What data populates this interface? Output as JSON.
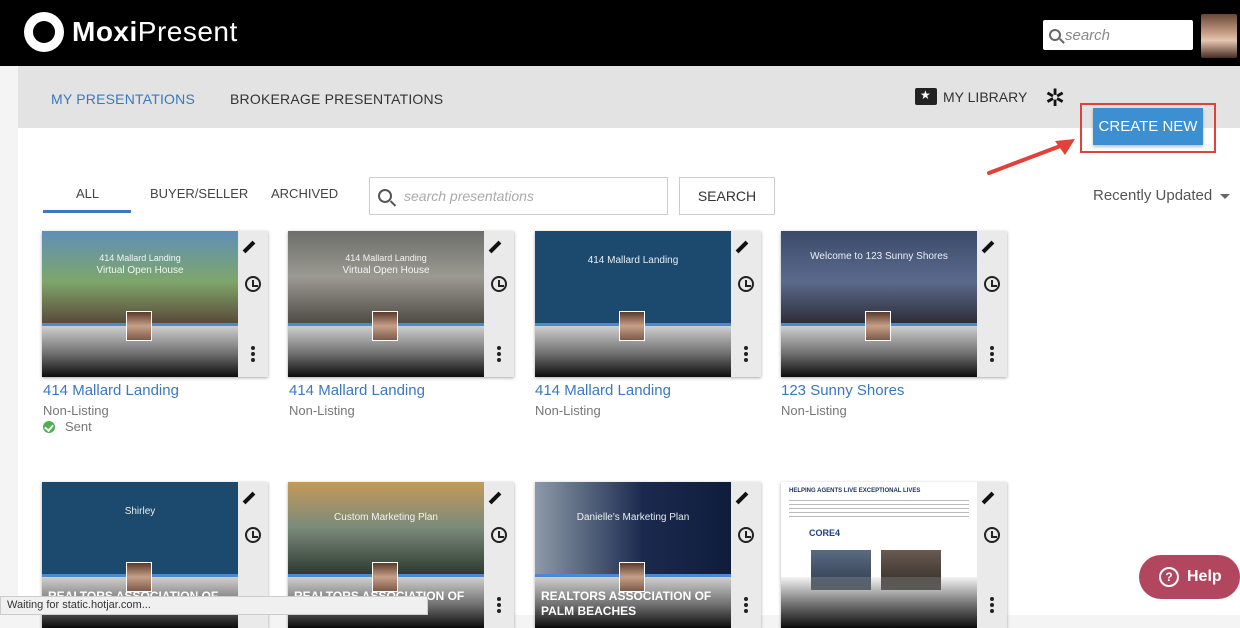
{
  "app": {
    "logo_bold": "Moxi",
    "logo_light": "Present",
    "search_placeholder": "search"
  },
  "nav": {
    "tabs": [
      "MY PRESENTATIONS",
      "BROKERAGE PRESENTATIONS"
    ],
    "library": "MY LIBRARY",
    "create_new": "CREATE NEW"
  },
  "filters": {
    "tabs": [
      "ALL",
      "BUYER/SELLER",
      "ARCHIVED"
    ],
    "search_placeholder": "search presentations",
    "search_button": "SEARCH",
    "sort": "Recently Updated"
  },
  "cards": [
    {
      "title": "414 Mallard Landing",
      "subtitle": "Non-Listing",
      "status": "Sent",
      "thumb_line": "414 Mallard Landing",
      "thumb_title": "Virtual Open House"
    },
    {
      "title": "414 Mallard Landing",
      "subtitle": "Non-Listing",
      "thumb_line": "414 Mallard Landing",
      "thumb_title": "Virtual Open House"
    },
    {
      "title": "414 Mallard Landing",
      "subtitle": "Non-Listing",
      "thumb_title": "414 Mallard Landing"
    },
    {
      "title": "123 Sunny Shores",
      "subtitle": "Non-Listing",
      "thumb_title": "Welcome to 123 Sunny Shores"
    },
    {
      "thumb_title": "Shirley",
      "caption": "REALTORS ASSOCIATION OF"
    },
    {
      "thumb_title": "Custom Marketing Plan",
      "caption": "REALTORS ASSOCIATION OF"
    },
    {
      "thumb_title": "Danielle's Marketing Plan",
      "caption": "REALTORS ASSOCIATION OF PALM BEACHES"
    },
    {
      "thumb_title": "HELPING AGENTS LIVE EXCEPTIONAL LIVES",
      "thumb_sub": "CORE4"
    }
  ],
  "browser_status": "Waiting for static.hotjar.com...",
  "help": "Help",
  "colors": {
    "accent": "#3a78c0",
    "create": "#3c8fd0",
    "help": "#b2465f",
    "highlight": "#e0413a"
  }
}
